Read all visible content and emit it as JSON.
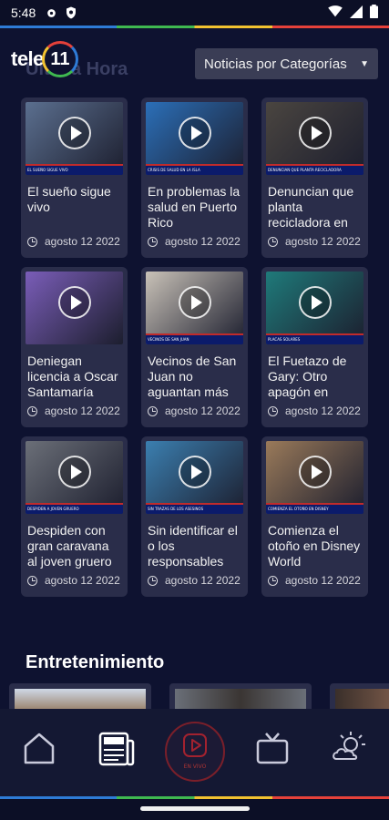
{
  "status_bar": {
    "time": "5:48"
  },
  "header": {
    "logo_text": "tele",
    "logo_number": "11",
    "section_title": "Última Hora",
    "category_select": "Noticias por Categorías"
  },
  "news": [
    {
      "title": "El sueño sigue vivo",
      "date": "agosto 12 2022",
      "caption": "EL SUEÑO SIGUE VIVO",
      "bg": "#5b6f8f"
    },
    {
      "title": "En problemas la salud en Puerto Rico",
      "date": "agosto 12 2022",
      "caption": "CRISIS DE SALUD EN LA ISLA",
      "bg": "#2b6fb8"
    },
    {
      "title": "Denuncian que planta recicladora en Carolina derr…",
      "date": "agosto 12 2022",
      "caption": "DENUNCIAN QUE PLANTA RECICLADORA",
      "bg": "#4a4540"
    },
    {
      "title": "Deniegan licencia a Oscar Santamaría",
      "date": "agosto 12 2022",
      "caption": "",
      "bg": "#7a5db8"
    },
    {
      "title": "Vecinos de San Juan no aguantan más la pesadilla…",
      "date": "agosto 12 2022",
      "caption": "VECINOS DE SAN JUAN",
      "bg": "#c9c2b8"
    },
    {
      "title": "El Fuetazo de Gary: Otro apagón en Puerto Rico",
      "date": "agosto 12 2022",
      "caption": "PLACAS SOLARES",
      "bg": "#1f7a7a"
    },
    {
      "title": "Despiden con gran caravana al joven gruero a…",
      "date": "agosto 12 2022",
      "caption": "DESPIDEN A JOVEN GRUERO",
      "bg": "#6b6f78"
    },
    {
      "title": "Sin identificar el o los responsables del asesinato de…",
      "date": "agosto 12 2022",
      "caption": "SIN TRAZAS DE LOS ASESINOS",
      "bg": "#3b7fb0"
    },
    {
      "title": "Comienza el otoño en Disney World",
      "date": "agosto 12 2022",
      "caption": "COMIENZA EL OTOÑO EN DISNEY",
      "bg": "#9a7a5a"
    }
  ],
  "entertainment": {
    "title": "Entretenimiento"
  },
  "bottom_nav": {
    "live_label": "EN VIVO"
  },
  "colors": {
    "background": "#0e1230",
    "card": "#2a2d4a",
    "accent_red": "#e6413a",
    "news_band": "#0b1b6b"
  }
}
